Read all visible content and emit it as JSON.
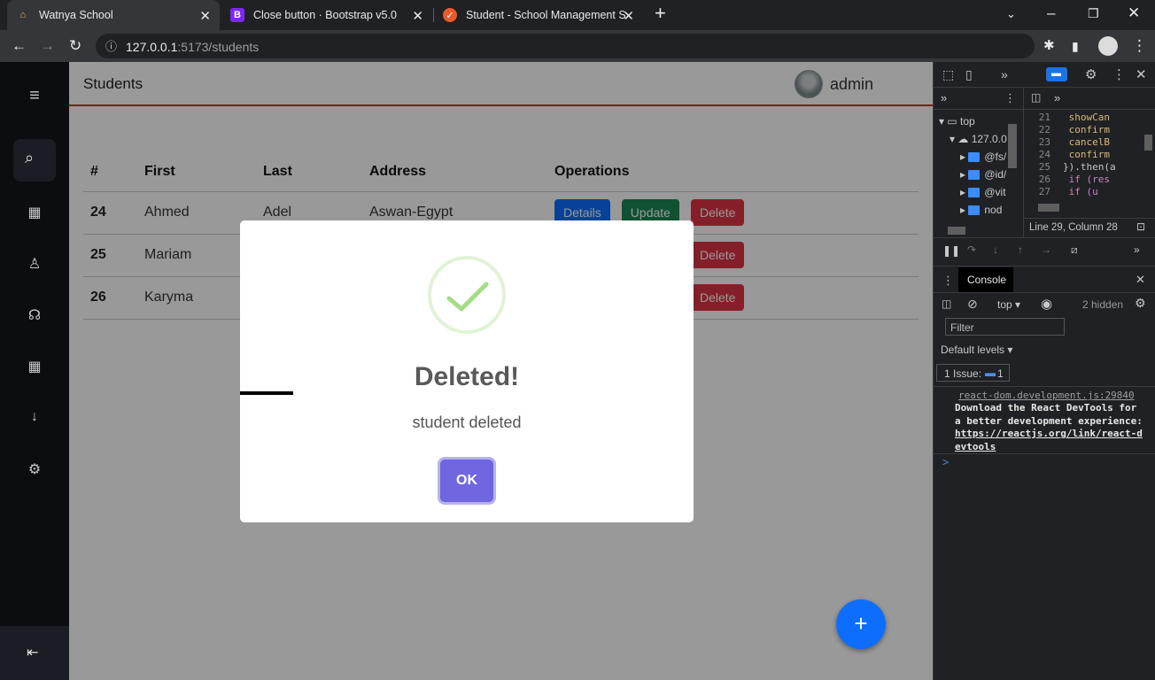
{
  "browser": {
    "tabs": [
      {
        "title": "Watnya School",
        "active": true
      },
      {
        "title": "Close button · Bootstrap v5.0",
        "active": false
      },
      {
        "title": "Student - School Management Sy",
        "active": false
      }
    ],
    "url_host": "127.0.0.1",
    "url_path": ":5173/students",
    "new_tab": "+"
  },
  "app": {
    "page_title": "Students",
    "user_name": "admin",
    "table": {
      "headers": [
        "#",
        "First",
        "Last",
        "Address",
        "Operations"
      ],
      "rows": [
        {
          "id": "24",
          "first": "Ahmed",
          "last": "Adel",
          "address": "Aswan-Egypt"
        },
        {
          "id": "25",
          "first": "Mariam",
          "last": "",
          "address": ""
        },
        {
          "id": "26",
          "first": "Karyma",
          "last": "",
          "address": ""
        }
      ],
      "btn_details": "Details",
      "btn_update": "Update",
      "btn_delete": "Delete"
    },
    "fab_label": "+"
  },
  "modal": {
    "title": "Deleted!",
    "text": "student deleted",
    "ok": "OK"
  },
  "devtools": {
    "sources_top": "top",
    "sources_host": "127.0.0",
    "tree": [
      "@fs/",
      "@id/",
      "@vit",
      "nod"
    ],
    "code_lines": [
      {
        "n": "21",
        "code": "    showCan"
      },
      {
        "n": "22",
        "code": "    confirm"
      },
      {
        "n": "23",
        "code": "    cancelB"
      },
      {
        "n": "24",
        "code": "    confirm"
      },
      {
        "n": "25",
        "code": "}).then(a"
      },
      {
        "n": "26",
        "code": "  if (res"
      },
      {
        "n": "27",
        "code": "    if (u"
      }
    ],
    "cursor_pos": "Line 29, Column 28",
    "console_tab": "Console",
    "context": "top",
    "hidden": "2 hidden",
    "filter_placeholder": "Filter",
    "levels": "Default levels",
    "issues_label": "1 Issue:",
    "issues_count": "1",
    "source_link": "react-dom.development.js:29840",
    "message": "Download the React DevTools for a better development experience:",
    "message_link": "https://reactjs.org/link/react-devtools",
    "prompt": ">"
  }
}
